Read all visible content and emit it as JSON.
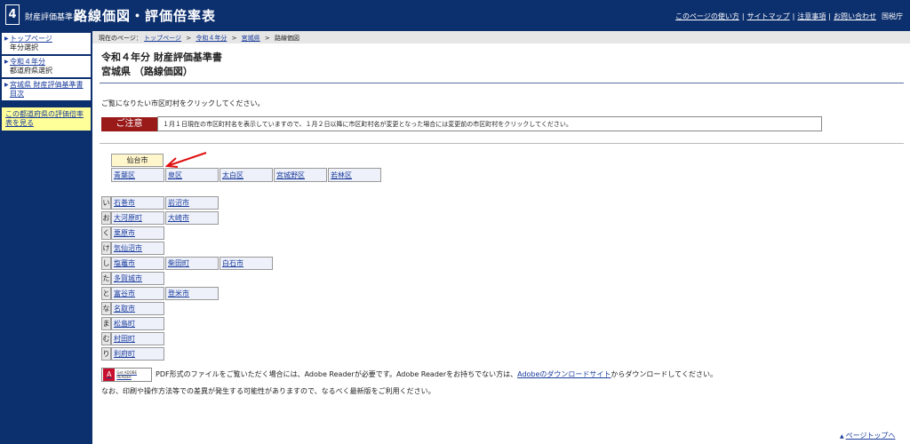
{
  "header": {
    "logo_number": "4",
    "logo_small": "財産評価基準書",
    "logo_big": "路線価図・評価倍率表",
    "links": [
      "このページの使い方",
      "サイトマップ",
      "注意事項",
      "お問い合わせ"
    ],
    "agency": "国税庁"
  },
  "sidebar": {
    "items": [
      {
        "link": "トップページ",
        "sub": "年分選択"
      },
      {
        "link": "令和４年分",
        "sub": "都道府県選択"
      },
      {
        "link": "宮城県 財産評価基準書目次",
        "sub": ""
      }
    ],
    "note": "この都道府県の評価倍率表を見る"
  },
  "breadcrumb": {
    "prefix": "現在のページ：",
    "items": [
      "トップページ",
      "令和４年分",
      "宮城県",
      "路線価図"
    ],
    "separator": ">"
  },
  "title": {
    "line1": "令和４年分 財産評価基準書",
    "line2": "宮城県 （路線価図）"
  },
  "instruction": "ご覧になりたい市区町村をクリックしてください。",
  "notice": {
    "label": "ご注意",
    "text": "１月１日現在の市区町村名を表示していますので、１月２日以降に市区町村名が変更となった場合には変更前の市区町村をクリックしてください。"
  },
  "sendai": {
    "head": "仙台市",
    "wards": [
      "青葉区",
      "泉区",
      "太白区",
      "宮城野区",
      "若林区"
    ]
  },
  "municipalities": [
    {
      "kana": "い",
      "cities": [
        "石巻市",
        "岩沼市"
      ]
    },
    {
      "kana": "お",
      "cities": [
        "大河原町",
        "大崎市"
      ]
    },
    {
      "kana": "く",
      "cities": [
        "栗原市"
      ]
    },
    {
      "kana": "け",
      "cities": [
        "気仙沼市"
      ]
    },
    {
      "kana": "し",
      "cities": [
        "塩竈市",
        "柴田町",
        "白石市"
      ]
    },
    {
      "kana": "た",
      "cities": [
        "多賀城市"
      ]
    },
    {
      "kana": "と",
      "cities": [
        "富谷市",
        "登米市"
      ]
    },
    {
      "kana": "な",
      "cities": [
        "名取市"
      ]
    },
    {
      "kana": "ま",
      "cities": [
        "松島町"
      ]
    },
    {
      "kana": "む",
      "cities": [
        "村田町"
      ]
    },
    {
      "kana": "り",
      "cities": [
        "利府町"
      ]
    }
  ],
  "pdf": {
    "badge_small": "Get ADOBE READER",
    "line1_before": "PDF形式のファイルをご覧いただく場合には、Adobe Readerが必要です。Adobe Readerをお持ちでない方は、",
    "line1_link": "Adobeのダウンロードサイト",
    "line1_after": "からダウンロードしてください。",
    "line2": "なお、印刷や操作方法等での差異が発生する可能性がありますので、なるべく最新版をご利用ください。"
  },
  "pagetop": "ページトップへ",
  "colors": {
    "header_bg": "#0c2f6e",
    "notice_label_bg": "#9a1a1a",
    "note_bg": "#ffff99",
    "arrow": "#e01010"
  }
}
